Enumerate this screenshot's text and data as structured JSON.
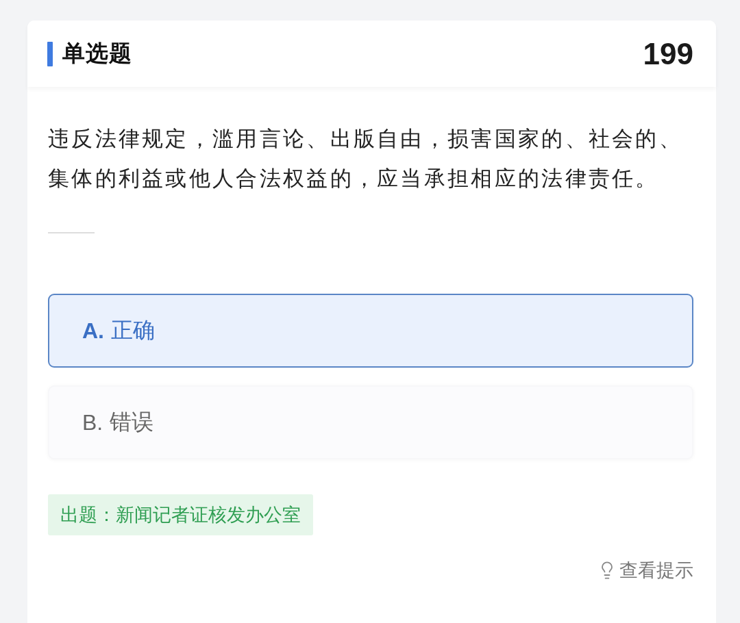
{
  "header": {
    "title": "单选题",
    "number": "199"
  },
  "question": {
    "text": "违反法律规定，滥用言论、出版自由，损害国家的、社会的、集体的利益或他人合法权益的，应当承担相应的法律责任。"
  },
  "options": [
    {
      "letter": "A.",
      "text": "正确",
      "selected": true
    },
    {
      "letter": "B.",
      "text": "错误",
      "selected": false
    }
  ],
  "source_tag": {
    "text": "出题：新闻记者证核发办公室"
  },
  "hint_link": {
    "label": "查看提示"
  }
}
